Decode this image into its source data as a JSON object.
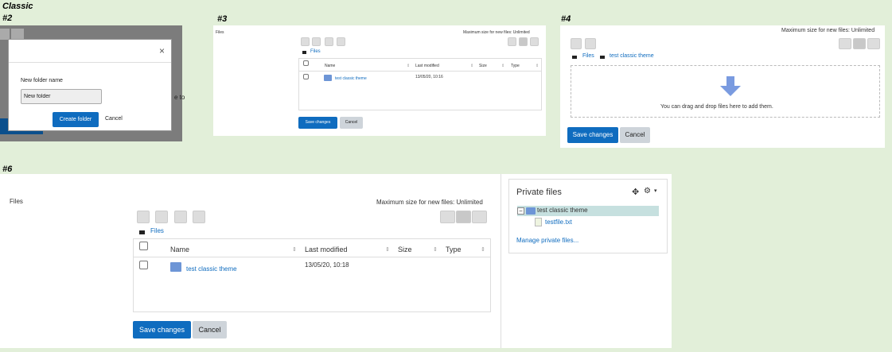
{
  "labels": {
    "classic": "Classic",
    "p2": "#2",
    "p3": "#3",
    "p4": "#4",
    "p6": "#6"
  },
  "dialog": {
    "field_label": "New folder name",
    "field_value": "New folder",
    "create_button": "Create folder",
    "cancel_button": "Cancel",
    "close": "×",
    "behind_text": "e to"
  },
  "panel3": {
    "section_title": "Files",
    "max_size": "Maximum size for new files: Unlimited",
    "breadcrumb": "Files",
    "headers": {
      "name": "Name",
      "modified": "Last modified",
      "size": "Size",
      "type": "Type"
    },
    "row": {
      "name": "test classic theme",
      "modified": "13/05/20, 10:16"
    },
    "save_button": "Save changes",
    "cancel_button": "Cancel"
  },
  "panel4": {
    "max_size": "Maximum size for new files: Unlimited",
    "breadcrumb_root": "Files",
    "breadcrumb_folder": "test classic theme",
    "drop_text": "You can drag and drop files here to add them.",
    "save_button": "Save changes",
    "cancel_button": "Cancel"
  },
  "panel6": {
    "section_title": "Files",
    "max_size": "Maximum size for new files: Unlimited",
    "breadcrumb": "Files",
    "headers": {
      "name": "Name",
      "modified": "Last modified",
      "size": "Size",
      "type": "Type"
    },
    "row": {
      "name": "test classic theme",
      "modified": "13/05/20, 10:18"
    },
    "save_button": "Save changes",
    "cancel_button": "Cancel",
    "private_files": {
      "title": "Private files",
      "tree_folder": "test classic theme",
      "tree_file": "testfile.txt",
      "manage_link": "Manage private files...",
      "tree_toggle": "−"
    }
  },
  "colors": {
    "primary": "#0f6cbf",
    "background": "#e2efd9",
    "secondary": "#ced4da"
  }
}
